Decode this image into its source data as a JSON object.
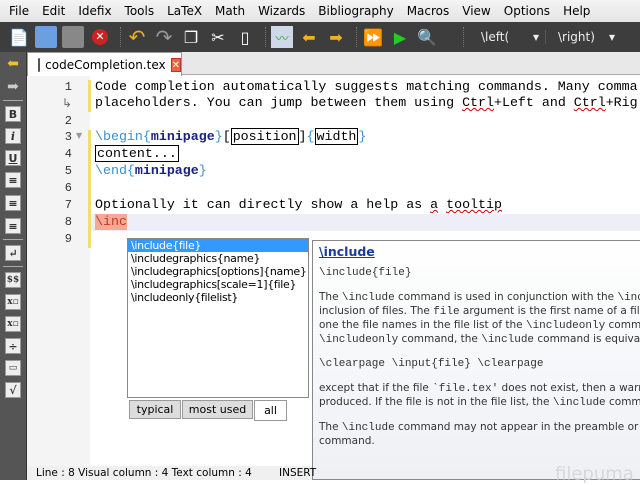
{
  "menu": [
    "File",
    "Edit",
    "Idefix",
    "Tools",
    "LaTeX",
    "Math",
    "Wizards",
    "Bibliography",
    "Macros",
    "View",
    "Options",
    "Help"
  ],
  "toolbar": {
    "icons": [
      "new-file-icon",
      "open-icon",
      "save-icon",
      "close-icon",
      "undo-icon",
      "redo-icon",
      "copy-icon",
      "cut-icon",
      "paste-icon",
      "check-icon",
      "prev-mark-icon",
      "next-mark-icon",
      "build-view-icon",
      "compile-icon",
      "view-icon"
    ],
    "left_combo": "\\left(",
    "right_combo": "\\right)"
  },
  "tab": {
    "title": "codeCompletion.tex"
  },
  "editor": {
    "line_numbers": [
      "1",
      "2",
      "3",
      "4",
      "5",
      "6",
      "7",
      "8",
      "9"
    ],
    "line1": "Code completion automatically suggests matching commands. Many comma",
    "line1b_pre": "placeholders. You can jump between them using ",
    "ctrl": "Ctrl",
    "line1b_mid": "+Left and ",
    "line1b_end": "+Rig",
    "begin": "\\begin",
    "lb": "{",
    "minipage": "minipage",
    "rb": "}",
    "pos": "position",
    "width": "width",
    "content": "content...",
    "end": "\\end",
    "line7_pre": "Optionally it can directly show a help as ",
    "a": "a",
    "tooltip": "tooltip",
    "line8": "\\inc"
  },
  "completion": {
    "items": [
      "\\include{file}",
      "\\includegraphics{name}",
      "\\includegraphics[options]{name}",
      "\\includegraphics[scale=1]{file}",
      "\\includeonly{filelist}"
    ],
    "selected": 0,
    "tabs": [
      "typical",
      "most used",
      "all"
    ],
    "active_tab": "all"
  },
  "help": {
    "title": "\\include",
    "syntax": "\\include{file}",
    "p1": [
      [
        "The ",
        "\\include",
        " command is used in conjunction with the ",
        "\\includ"
      ],
      [
        "inclusion of files. The ",
        "file",
        " argument is the first name of a file, den",
        ""
      ],
      [
        "one the file names in the file list of the ",
        "\\includeonly",
        " command c",
        ""
      ],
      [
        "",
        "\\includeonly",
        " command, the ",
        "\\include",
        " command is equivalent"
      ]
    ],
    "syntax2": "\\clearpage \\input{file} \\clearpage",
    "p2": [
      [
        "except that if the file ",
        "`file.tex'",
        " does not exist, then a warning"
      ],
      [
        "produced. If the file is not in the file list, the ",
        "\\include",
        " command i"
      ]
    ],
    "p3": [
      [
        "The ",
        "\\include",
        " command may not appear in the preamble or in a fi"
      ],
      [
        "command.",
        "",
        ""
      ]
    ]
  },
  "status": {
    "text": "Line : 8 Visual column : 4 Text column : 4",
    "mode": "INSERT"
  },
  "watermark": "filepuma"
}
